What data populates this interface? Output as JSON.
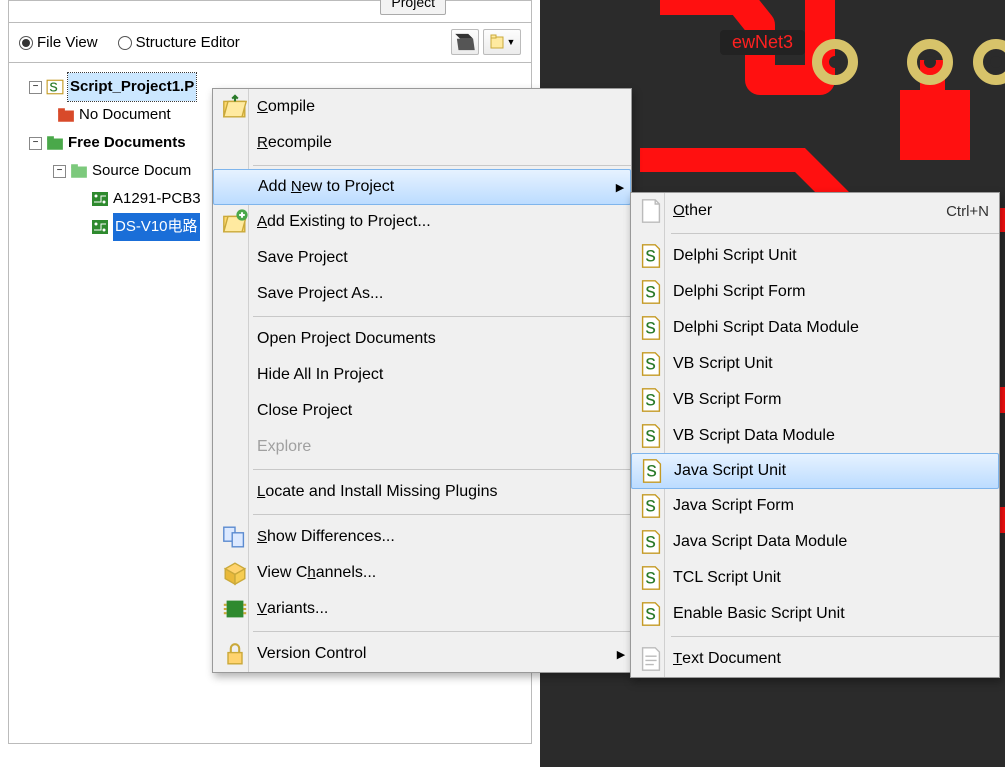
{
  "toolbar": {
    "project_button": "Project",
    "file_view": "File View",
    "structure_editor": "Structure Editor"
  },
  "tree": {
    "root": "Script_Project1.P",
    "items": [
      {
        "label": "No Document"
      },
      {
        "label": "Free Documents",
        "bold": true
      },
      {
        "label": "Source Docum"
      },
      {
        "label": "A1291-PCB3"
      },
      {
        "label": "DS-V10电路",
        "selected": true
      }
    ]
  },
  "pcb": {
    "net_label": "ewNet3"
  },
  "context_menu": {
    "items": [
      {
        "label": "Compile",
        "u": "C"
      },
      {
        "label": "Recompile",
        "u": "R"
      },
      {
        "sep": true
      },
      {
        "label": "Add New to Project",
        "u": "N",
        "highlight": true,
        "arrow": true
      },
      {
        "label": "Add Existing to Project...",
        "u": "A"
      },
      {
        "label": "Save Project"
      },
      {
        "label": "Save Project As..."
      },
      {
        "sep": true
      },
      {
        "label": "Open Project Documents"
      },
      {
        "label": "Hide All In Project"
      },
      {
        "label": "Close Project"
      },
      {
        "label": "Explore",
        "disabled": true
      },
      {
        "sep": true
      },
      {
        "label": "Locate and Install Missing Plugins",
        "u": "L"
      },
      {
        "sep": true
      },
      {
        "label": "Show Differences...",
        "u": "S"
      },
      {
        "label": "View Channels...",
        "u": "h"
      },
      {
        "label": "Variants...",
        "u": "V"
      },
      {
        "sep": true
      },
      {
        "label": "Version Control",
        "arrow": true
      }
    ]
  },
  "submenu": {
    "items": [
      {
        "label": "Other",
        "u": "O",
        "shortcut": "Ctrl+N"
      },
      {
        "sep": true
      },
      {
        "label": "Delphi Script Unit"
      },
      {
        "label": "Delphi Script Form"
      },
      {
        "label": "Delphi Script Data Module"
      },
      {
        "label": "VB Script Unit"
      },
      {
        "label": "VB Script Form"
      },
      {
        "label": "VB Script Data Module"
      },
      {
        "label": "Java Script Unit",
        "highlight": true
      },
      {
        "label": "Java Script Form"
      },
      {
        "label": "Java Script Data Module"
      },
      {
        "label": "TCL Script Unit"
      },
      {
        "label": "Enable Basic Script Unit"
      },
      {
        "sep": true
      },
      {
        "label": "Text Document",
        "u": "T"
      }
    ]
  },
  "icons": {
    "compile": "folder-open-arrow",
    "add_existing": "folder-plus",
    "show_diff": "pages-compare",
    "view_channels": "cube",
    "variants": "chip",
    "version_control": "lock",
    "doc": "document",
    "script_doc": "script-doc",
    "text_doc": "text-doc"
  }
}
